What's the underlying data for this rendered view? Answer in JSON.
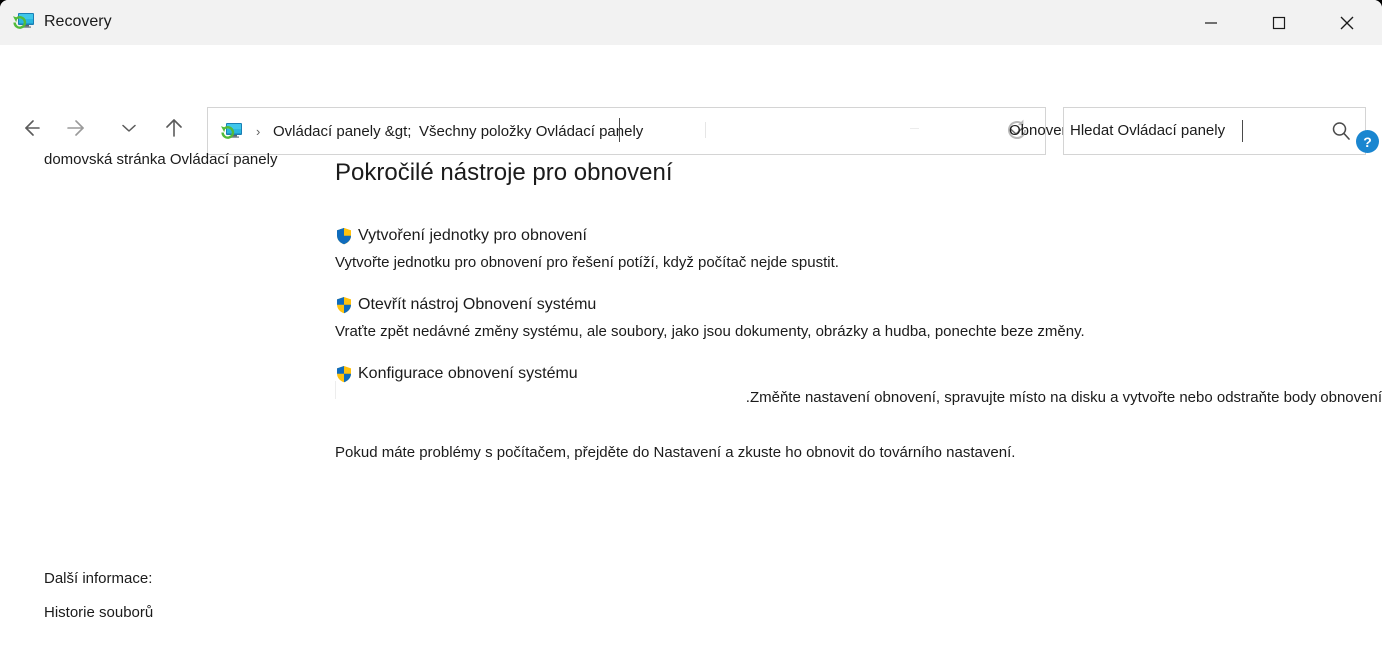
{
  "window": {
    "title": "Recovery",
    "icon": "recovery-monitor-icon",
    "controls": {
      "minimize": "Minimize",
      "maximize": "Maximize",
      "close": "Close"
    }
  },
  "navigation": {
    "back": "Back",
    "forward": "Forward",
    "recent": "Recent locations",
    "up": "Up one level",
    "address": {
      "icon": "recovery-monitor-icon",
      "separator": "›",
      "crumb1": "Ovládací panely &gt;",
      "crumb2": "Všechny položky Ovládací panely",
      "dropdown": "chevron-down-icon"
    },
    "refresh": {
      "icon": "refresh-icon",
      "label": "Obnovení"
    },
    "search": {
      "value": "Hledat Ovládací panely",
      "placeholder": "Hledat Ovládací panely",
      "icon": "search-icon"
    }
  },
  "help": {
    "label": "?",
    "color": "#1a86d0"
  },
  "sidebar": {
    "home_link": "domovská stránka Ovládací panely",
    "more_info_label": "Další informace:",
    "links": [
      {
        "label": "Historie souborů"
      }
    ]
  },
  "main": {
    "heading": "Pokročilé nástroje pro obnovení",
    "tasks": [
      {
        "icon": "shield-icon",
        "title": "Vytvoření jednotky pro obnovení",
        "description": "Vytvořte jednotku pro obnovení pro řešení potíží, když počítač nejde spustit."
      },
      {
        "icon": "shield-icon",
        "title": "Otevřít nástroj Obnovení systému",
        "description": "Vraťte zpět nedávné změny systému, ale soubory, jako jsou dokumenty, obrázky a hudba, ponechte beze změny."
      },
      {
        "icon": "shield-icon",
        "title": "Konfigurace obnovení systému",
        "description": ".Změňte nastavení obnovení, spravujte místo na disku a vytvořte nebo odstraňte body obnovení"
      }
    ],
    "footer_note": "Pokud máte problémy s počítačem, přejděte do Nastavení a zkuste ho obnovit do továrního nastavení."
  },
  "colors": {
    "titlebar_bg": "#f2f2f2",
    "content_bg": "#ffffff",
    "text": "#1b1b1b",
    "border": "#d4d4d4",
    "accent": "#1a86d0",
    "shield_blue": "#0f6cbd",
    "shield_yellow": "#ffc20e"
  }
}
